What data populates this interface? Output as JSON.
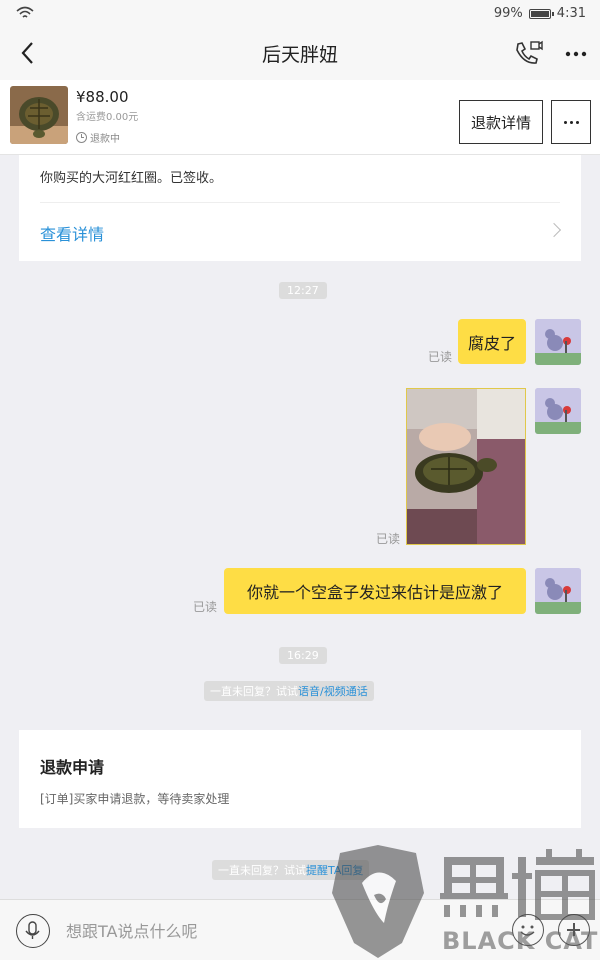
{
  "status_bar": {
    "battery": "99%",
    "time": "4:31",
    "battery_level": 0.99
  },
  "nav": {
    "title": "后天胖妞"
  },
  "product": {
    "price": "¥88.00",
    "shipping": "含运费0.00元",
    "status": "退款中",
    "refund_button": "退款详情"
  },
  "order_card": {
    "text": "你购买的大河红红圈。已签收。",
    "link": "查看详情"
  },
  "chat": {
    "time1": "12:27",
    "msg1": {
      "text": "腐皮了",
      "read": "已读"
    },
    "msg2": {
      "read": "已读"
    },
    "msg3": {
      "text": "你就一个空盒子发过来估计是应激了",
      "read": "已读"
    },
    "time2": "16:29",
    "sys1": {
      "text": "一直未回复？试试",
      "link": "语音/视频通话"
    },
    "sys2": {
      "text": "一直未回复？试试",
      "link": "提醒TA回复"
    }
  },
  "refund_card": {
    "title": "退款申请",
    "desc": "[订单]买家申请退款，等待卖家处理"
  },
  "input": {
    "placeholder": "想跟TA说点什么呢"
  },
  "watermark": {
    "text": "黑猫",
    "subtext": "BLACK CAT"
  },
  "colors": {
    "bubble": "#fedd45",
    "link": "#2a91d8",
    "background": "#efeff3"
  },
  "icons": [
    "wifi-icon",
    "battery-icon",
    "back-icon",
    "phone-video-icon",
    "more-icon",
    "clock-icon",
    "chevron-right-icon",
    "mic-icon",
    "emoji-icon",
    "plus-icon"
  ]
}
